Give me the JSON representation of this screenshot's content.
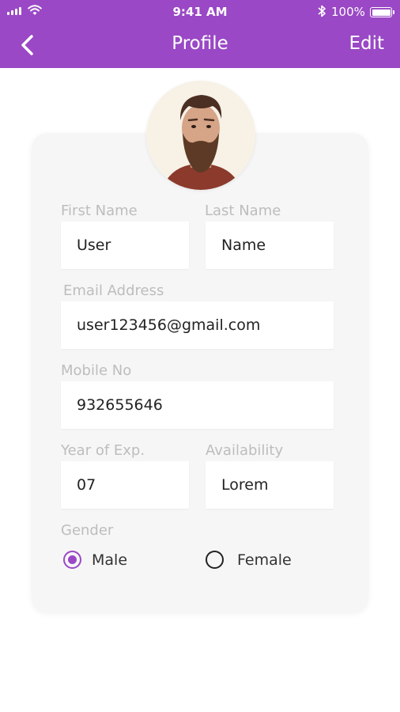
{
  "status_bar": {
    "time": "9:41 AM",
    "battery": "100%"
  },
  "header": {
    "title": "Profile",
    "edit_label": "Edit"
  },
  "colors": {
    "accent": "#9a48c6",
    "card_bg": "#f6f6f6",
    "label": "#bdbdbd"
  },
  "form": {
    "first_name": {
      "label": "First Name",
      "value": "User"
    },
    "last_name": {
      "label": "Last Name",
      "value": "Name"
    },
    "email": {
      "label": "Email Address",
      "value": "user123456@gmail.com"
    },
    "mobile": {
      "label": "Mobile No",
      "value": "932655646"
    },
    "experience": {
      "label": "Year of Exp.",
      "value": "07"
    },
    "availability": {
      "label": "Availability",
      "value": "Lorem"
    },
    "gender": {
      "label": "Gender",
      "options": [
        "Male",
        "Female"
      ],
      "selected": "Male"
    }
  }
}
